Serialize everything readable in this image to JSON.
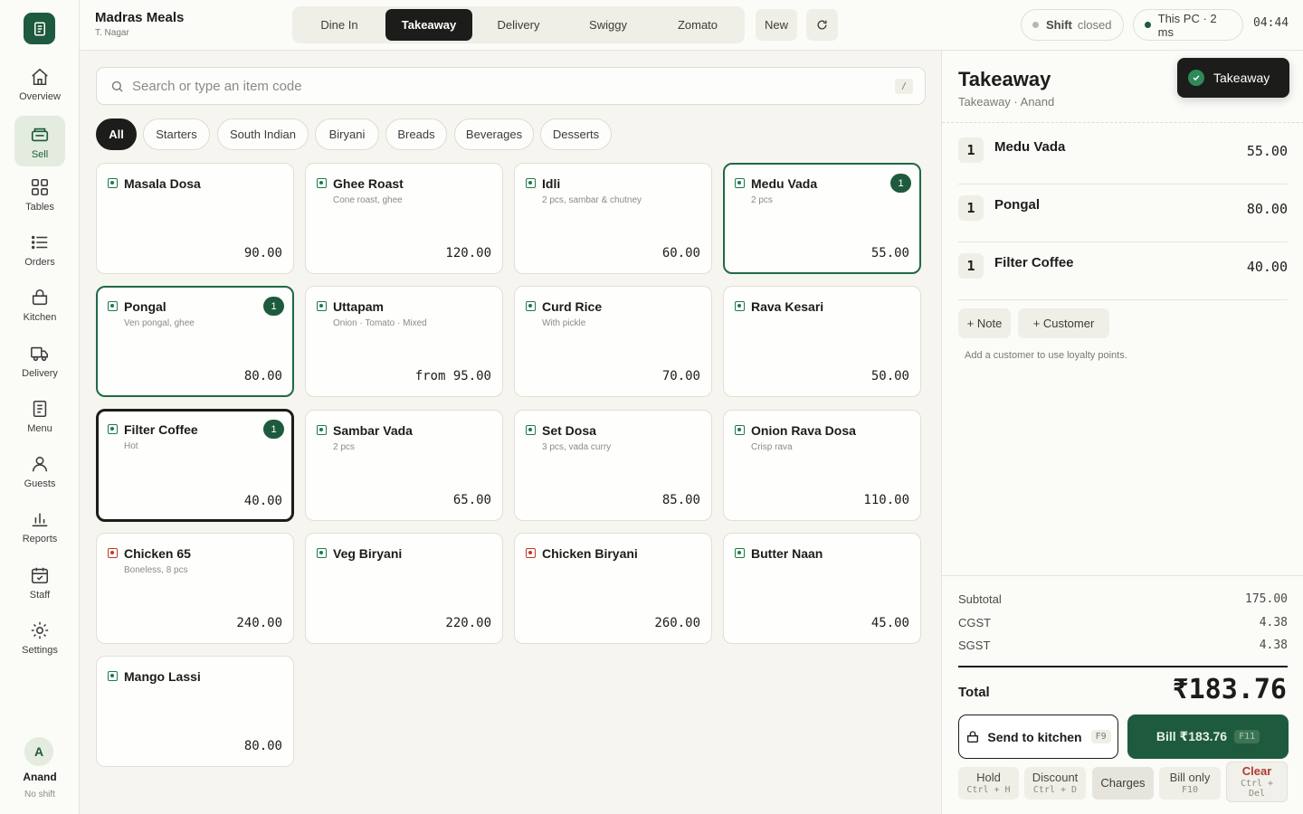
{
  "app": {
    "store_name": "Madras Meals",
    "store_location": "T. Nagar"
  },
  "sidebar": {
    "items": [
      {
        "label": "Overview",
        "icon": "home-icon"
      },
      {
        "label": "Sell",
        "icon": "register-icon",
        "active": true
      },
      {
        "label": "Tables",
        "icon": "grid-icon"
      },
      {
        "label": "Orders",
        "icon": "list-icon"
      },
      {
        "label": "Kitchen",
        "icon": "pot-icon"
      },
      {
        "label": "Delivery",
        "icon": "truck-icon"
      },
      {
        "label": "Menu",
        "icon": "menu-icon"
      },
      {
        "label": "Guests",
        "icon": "user-icon"
      },
      {
        "label": "Reports",
        "icon": "bar-chart-icon"
      },
      {
        "label": "Staff",
        "icon": "calendar-check-icon"
      },
      {
        "label": "Settings",
        "icon": "gear-icon"
      }
    ],
    "user": {
      "initial": "A",
      "name": "Anand",
      "status": "No shift"
    }
  },
  "topbar": {
    "modes": [
      "Dine In",
      "Takeaway",
      "Delivery",
      "Swiggy",
      "Zomato"
    ],
    "active_mode": "Takeaway",
    "new_label": "New",
    "refresh_icon": "refresh-icon",
    "shift_label": "Shift",
    "shift_status": "closed",
    "device_status": "This PC · 2 ms",
    "clock": "04:44"
  },
  "search": {
    "placeholder": "Search or type an item code",
    "value": "",
    "shortcut": "/"
  },
  "categories": [
    "All",
    "Starters",
    "South Indian",
    "Biryani",
    "Breads",
    "Beverages",
    "Desserts"
  ],
  "active_category": "All",
  "menu_items": [
    {
      "name": "Masala Dosa",
      "desc": "",
      "price": "90.00",
      "veg": true
    },
    {
      "name": "Ghee Roast",
      "desc": "Cone roast, ghee",
      "price": "120.00",
      "veg": true
    },
    {
      "name": "Idli",
      "desc": "2 pcs, sambar & chutney",
      "price": "60.00",
      "veg": true
    },
    {
      "name": "Medu Vada",
      "desc": "2 pcs",
      "price": "55.00",
      "veg": true,
      "qty": "1"
    },
    {
      "name": "Pongal",
      "desc": "Ven pongal, ghee",
      "price": "80.00",
      "veg": true,
      "qty": "1"
    },
    {
      "name": "Uttapam",
      "desc": "Onion · Tomato · Mixed",
      "price": "from 95.00",
      "veg": true
    },
    {
      "name": "Curd Rice",
      "desc": "With pickle",
      "price": "70.00",
      "veg": true
    },
    {
      "name": "Rava Kesari",
      "desc": "",
      "price": "50.00",
      "veg": true
    },
    {
      "name": "Filter Coffee",
      "desc": "Hot",
      "price": "40.00",
      "veg": true,
      "qty": "1"
    },
    {
      "name": "Sambar Vada",
      "desc": "2 pcs",
      "price": "65.00",
      "veg": true
    },
    {
      "name": "Set Dosa",
      "desc": "3 pcs, vada curry",
      "price": "85.00",
      "veg": true
    },
    {
      "name": "Onion Rava Dosa",
      "desc": "Crisp rava",
      "price": "110.00",
      "veg": true
    },
    {
      "name": "Chicken 65",
      "desc": "Boneless, 8 pcs",
      "price": "240.00",
      "veg": false
    },
    {
      "name": "Veg Biryani",
      "desc": "",
      "price": "220.00",
      "veg": true
    },
    {
      "name": "Chicken Biryani",
      "desc": "",
      "price": "260.00",
      "veg": false
    },
    {
      "name": "Butter Naan",
      "desc": "",
      "price": "45.00",
      "veg": true
    },
    {
      "name": "Mango Lassi",
      "desc": "",
      "price": "80.00",
      "veg": true
    }
  ],
  "order": {
    "title": "Takeaway",
    "subtitle": "Takeaway · Anand",
    "toast": "Takeaway",
    "lines": [
      {
        "qty": "1",
        "name": "Medu Vada",
        "price": "55.00"
      },
      {
        "qty": "1",
        "name": "Pongal",
        "price": "80.00"
      },
      {
        "qty": "1",
        "name": "Filter Coffee",
        "price": "40.00"
      }
    ],
    "note_label": "+ Note",
    "customer_label": "+ Customer",
    "customer_hint": "Add a customer to use loyalty points.",
    "totals": [
      {
        "label": "Subtotal",
        "value": "175.00"
      },
      {
        "label": "CGST",
        "value": "4.38"
      },
      {
        "label": "SGST",
        "value": "4.38"
      }
    ],
    "total_label": "Total",
    "total_value": "₹183.76",
    "send_label": "Send to kitchen",
    "send_key": "F9",
    "bill_label": "Bill ₹183.76",
    "bill_key": "F11",
    "actions": [
      {
        "label": "Hold",
        "key": "Ctrl + H"
      },
      {
        "label": "Discount",
        "key": "Ctrl + D"
      },
      {
        "label": "Charges",
        "key": ""
      },
      {
        "label": "Bill only",
        "key": "F10"
      },
      {
        "label": "Clear",
        "key": "Ctrl + Del"
      }
    ]
  },
  "colors": {
    "accent": "#1e5a3e",
    "background": "#f6f5ef",
    "veg": "#1e7a4a",
    "nonveg": "#c0392b",
    "danger": "#b03a2e"
  }
}
